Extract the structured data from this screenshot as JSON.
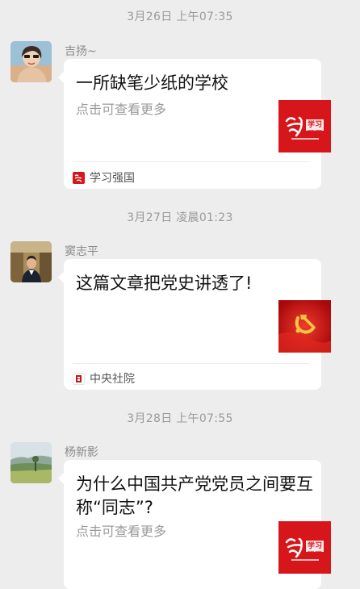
{
  "messages": [
    {
      "timestamp": "3月26日 上午07:35",
      "sender": "吉扬~",
      "title": "一所缺笔少纸的学校",
      "desc": "点击可查看更多",
      "thumb_text": "学习强国",
      "source": "学习强国",
      "source_icon": "xuexi-qiangguo-logo-icon"
    },
    {
      "timestamp": "3月27日 凌晨01:23",
      "sender": "窦志平",
      "title": "这篇文章把党史讲透了!",
      "desc": "",
      "source": "中央社院",
      "source_icon": "zhongyang-sheyuan-logo-icon"
    },
    {
      "timestamp": "3月28日 上午07:55",
      "sender": "杨新影",
      "title": "为什么中国共产党党员之间要互称“同志”?",
      "desc": "点击可查看更多",
      "thumb_text": "学习强国"
    }
  ],
  "colors": {
    "background": "#ededed",
    "card": "#ffffff",
    "brand_red": "#d7161b"
  }
}
